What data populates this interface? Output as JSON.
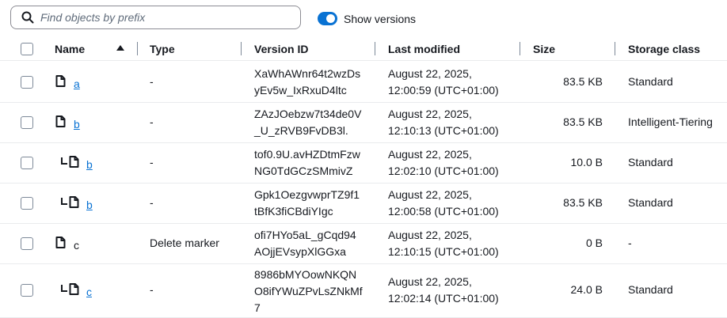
{
  "search": {
    "placeholder": "Find objects by prefix",
    "value": ""
  },
  "toggle": {
    "label": "Show versions",
    "on": true
  },
  "columns": {
    "name": "Name",
    "type": "Type",
    "version_id": "Version ID",
    "last_modified": "Last modified",
    "size": "Size",
    "storage_class": "Storage class"
  },
  "rows": [
    {
      "name": "a",
      "nested": false,
      "link": true,
      "type": "-",
      "version_line1": "XaWhAWnr64t2wzDs",
      "version_line2": "yEv5w_IxRxuD4ltc",
      "version_line3": "",
      "modified_line1": "August 22, 2025,",
      "modified_line2": "12:00:59 (UTC+01:00)",
      "size": "83.5 KB",
      "storage_class": "Standard"
    },
    {
      "name": "b",
      "nested": false,
      "link": true,
      "type": "-",
      "version_line1": "ZAzJOebzw7t34de0V",
      "version_line2": "_U_zRVB9FvDB3l.",
      "version_line3": "",
      "modified_line1": "August 22, 2025,",
      "modified_line2": "12:10:13 (UTC+01:00)",
      "size": "83.5 KB",
      "storage_class": "Intelligent-Tiering"
    },
    {
      "name": "b",
      "nested": true,
      "link": true,
      "type": "-",
      "version_line1": "tof0.9U.avHZDtmFzw",
      "version_line2": "NG0TdGCzSMmivZ",
      "version_line3": "",
      "modified_line1": "August 22, 2025,",
      "modified_line2": "12:02:10 (UTC+01:00)",
      "size": "10.0 B",
      "storage_class": "Standard"
    },
    {
      "name": "b",
      "nested": true,
      "link": true,
      "type": "-",
      "version_line1": "Gpk1OezgvwprTZ9f1",
      "version_line2": "tBfK3fiCBdiYIgc",
      "version_line3": "",
      "modified_line1": "August 22, 2025,",
      "modified_line2": "12:00:58 (UTC+01:00)",
      "size": "83.5 KB",
      "storage_class": "Standard"
    },
    {
      "name": "c",
      "nested": false,
      "link": false,
      "type": "Delete marker",
      "version_line1": "ofi7HYo5aL_gCqd94",
      "version_line2": "AOjjEVsypXlGGxa",
      "version_line3": "",
      "modified_line1": "August 22, 2025,",
      "modified_line2": "12:10:15 (UTC+01:00)",
      "size": "0 B",
      "storage_class": "-"
    },
    {
      "name": "c",
      "nested": true,
      "link": true,
      "type": "-",
      "version_line1": "8986bMYOowNKQN",
      "version_line2": "O8ifYWuZPvLsZNkMf",
      "version_line3": "7",
      "modified_line1": "August 22, 2025,",
      "modified_line2": "12:02:14 (UTC+01:00)",
      "size": "24.0 B",
      "storage_class": "Standard"
    }
  ],
  "colors": {
    "accent": "#0972d3",
    "text": "#16191f",
    "muted": "#5f6b7a",
    "border": "#e9ebed"
  }
}
